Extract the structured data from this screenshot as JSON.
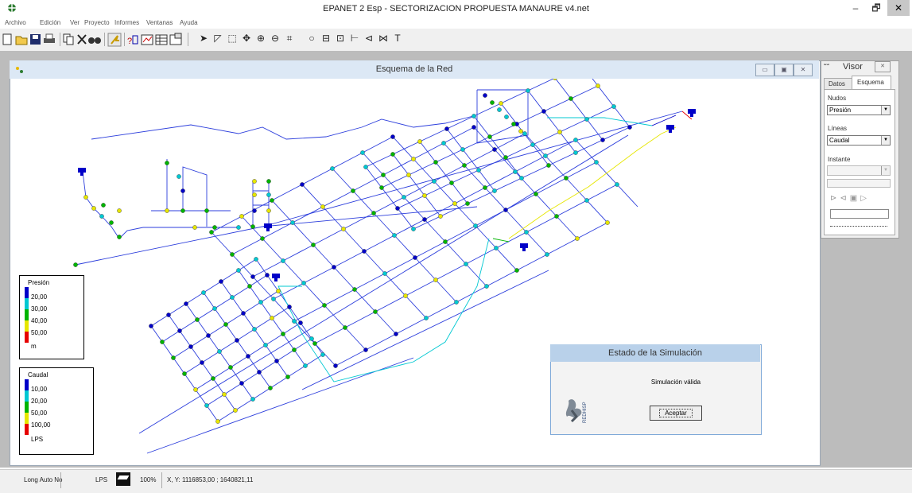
{
  "window": {
    "title": "EPANET 2 Esp - SECTORIZACION  PROPUESTA MANAURE v4.net",
    "minimize": "–",
    "maximize": "🗗",
    "close": "✕"
  },
  "menu": [
    "Archivo",
    "Edición",
    "Ver",
    "Proyecto",
    "Informes",
    "Ventanas",
    "Ayuda"
  ],
  "toolbar": {
    "file_icons": [
      "new-icon",
      "open-icon",
      "save-icon",
      "print-icon"
    ],
    "edit_icons": [
      "copy-icon",
      "delete-icon",
      "find-icon"
    ],
    "run_icon": "run-icon",
    "report_icons": [
      "query-icon",
      "graph-icon",
      "table-icon",
      "options-icon"
    ],
    "map_tools": [
      {
        "name": "select-icon",
        "glyph": "➤"
      },
      {
        "name": "select-vertex-icon",
        "glyph": "◸"
      },
      {
        "name": "select-region-icon",
        "glyph": "⬚"
      },
      {
        "name": "pan-icon",
        "glyph": "✥"
      },
      {
        "name": "zoom-in-icon",
        "glyph": "⊕"
      },
      {
        "name": "zoom-out-icon",
        "glyph": "⊖"
      },
      {
        "name": "full-extent-icon",
        "glyph": "⌗"
      },
      {
        "name": "add-junction-icon",
        "glyph": "○"
      },
      {
        "name": "add-reservoir-icon",
        "glyph": "⊟"
      },
      {
        "name": "add-tank-icon",
        "glyph": "⊡"
      },
      {
        "name": "add-pipe-icon",
        "glyph": "⊢"
      },
      {
        "name": "add-pump-icon",
        "glyph": "⊲"
      },
      {
        "name": "add-valve-icon",
        "glyph": "⋈"
      },
      {
        "name": "add-label-icon",
        "glyph": "T"
      }
    ]
  },
  "map": {
    "title": "Esquema de la Red",
    "legend_nodes": {
      "title": "Presión",
      "values": [
        "20,00",
        "30,00",
        "40,00",
        "50,00"
      ],
      "unit": "m"
    },
    "legend_links": {
      "title": "Caudal",
      "values": [
        "10,00",
        "20,00",
        "50,00",
        "100,00"
      ],
      "unit": "LPS"
    },
    "colors": [
      "#0000c8",
      "#00c8d2",
      "#00b400",
      "#e6e600",
      "#e60000"
    ],
    "pipe_color": "#2c3edc",
    "node_colors_count": 5
  },
  "dialog": {
    "title": "Estado de la Simulación",
    "message": "Simulación válida",
    "ok_label": "Aceptar",
    "logo_text": "REDHISP"
  },
  "visor": {
    "title": "Visor",
    "tabs": [
      "Datos",
      "Esquema"
    ],
    "nodes_label": "Nudos",
    "nodes_value": "Presión",
    "links_label": "Líneas",
    "links_value": "Caudal",
    "time_label": "Instante"
  },
  "status": {
    "auto_length": "Long Auto No",
    "flow_units": "LPS",
    "zoom": "100%",
    "coords": "X, Y: 1116853,00 ; 1640821,11"
  }
}
